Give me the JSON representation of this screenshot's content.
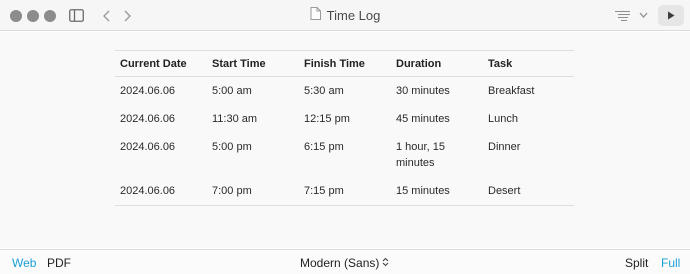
{
  "window": {
    "title": "Time Log"
  },
  "toolbar": {
    "sidebar_icon": "sidebar-icon",
    "back_icon": "chevron-left-icon",
    "forward_icon": "chevron-right-icon",
    "outline_icon": "outline-list-icon",
    "outline_menu_icon": "chevron-down-icon",
    "play_icon": "play-icon",
    "document_icon": "document-icon"
  },
  "table": {
    "headers": [
      "Current Date",
      "Start Time",
      "Finish Time",
      "Duration",
      "Task"
    ],
    "rows": [
      [
        "2024.06.06",
        "5:00 am",
        "5:30 am",
        "30 minutes",
        "Breakfast"
      ],
      [
        "2024.06.06",
        "11:30 am",
        "12:15 pm",
        "45 minutes",
        "Lunch"
      ],
      [
        "2024.06.06",
        "5:00 pm",
        "6:15 pm",
        "1 hour, 15 minutes",
        "Dinner"
      ],
      [
        "2024.06.06",
        "7:00 pm",
        "7:15 pm",
        "15 minutes",
        "Desert"
      ]
    ]
  },
  "footer": {
    "web_label": "Web",
    "pdf_label": "PDF",
    "theme_label": "Modern (Sans)",
    "split_label": "Split",
    "full_label": "Full",
    "selected_output": "Web",
    "selected_view": "Full"
  },
  "colors": {
    "accent": "#1a9fd6",
    "window_dot": "#8c8c8c"
  }
}
